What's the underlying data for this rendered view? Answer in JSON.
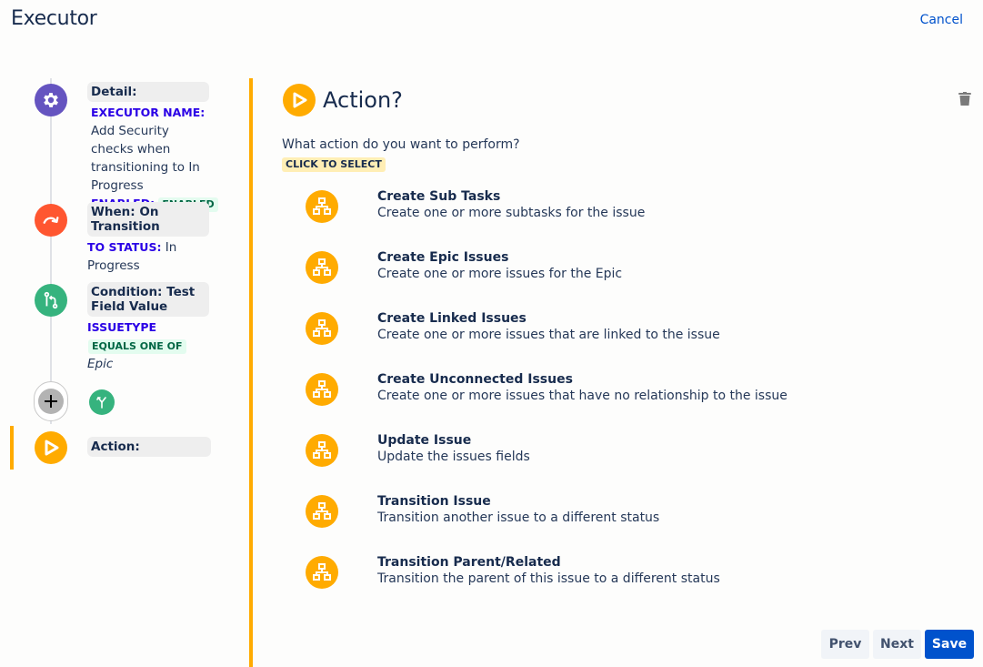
{
  "header": {
    "title": "Executor",
    "cancel_label": "Cancel"
  },
  "sidebar": {
    "steps": [
      {
        "title": "Detail:",
        "icon": "gear-icon",
        "color": "#6554c0",
        "field_label": "EXECUTOR NAME:",
        "field_value": "Add Security checks when transitioning to In Progress",
        "enabled_label": "ENABLED:",
        "enabled_badge": "ENABLED"
      },
      {
        "title": "When: On Transition",
        "icon": "transition-arrow-icon",
        "color": "#ff5630",
        "field_label": "TO STATUS:",
        "field_value": "In Progress"
      },
      {
        "title": "Condition: Test Field Value",
        "icon": "condition-branch-icon",
        "color": "#36b37e",
        "field_label": "ISSUETYPE",
        "operator_badge": "EQUALS ONE OF",
        "field_value": "Epic"
      },
      {
        "title": "Action:",
        "icon": "play-icon",
        "color": "#ffab00",
        "active": true
      }
    ],
    "add_step_icon": "plus-icon",
    "branch_icon": "branch-icon"
  },
  "main": {
    "title": "Action?",
    "question": "What action do you want to perform?",
    "select_badge": "CLICK TO SELECT",
    "accent_color": "#ffab00",
    "actions": [
      {
        "title": "Create Sub Tasks",
        "description": "Create one or more subtasks for the issue"
      },
      {
        "title": "Create Epic Issues",
        "description": "Create one or more issues for the Epic"
      },
      {
        "title": "Create Linked Issues",
        "description": "Create one or more issues that are linked to the issue"
      },
      {
        "title": "Create Unconnected Issues",
        "description": "Create one or more issues that have no relationship to the issue"
      },
      {
        "title": "Update Issue",
        "description": "Update the issues fields"
      },
      {
        "title": "Transition Issue",
        "description": "Transition another issue to a different status"
      },
      {
        "title": "Transition Parent/Related",
        "description": "Transition the parent of this issue to a different status"
      }
    ]
  },
  "footer": {
    "prev_label": "Prev",
    "next_label": "Next",
    "save_label": "Save"
  }
}
